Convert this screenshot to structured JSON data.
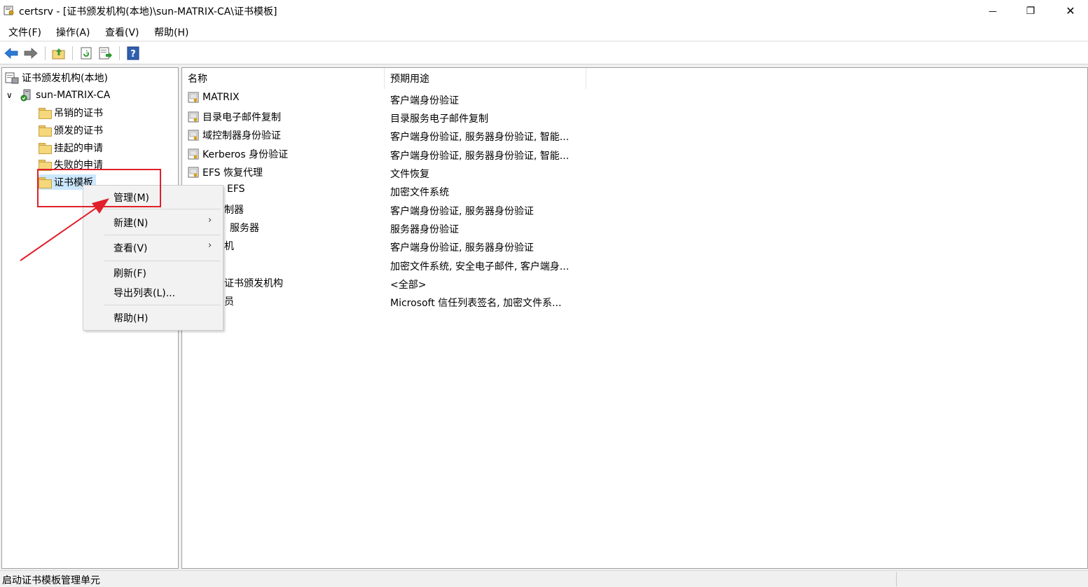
{
  "window": {
    "title": "certsrv - [证书颁发机构(本地)\\sun-MATRIX-CA\\证书模板]",
    "minimize_glyph": "—",
    "maximize_glyph": "❐",
    "close_glyph": "✕"
  },
  "menubar": {
    "items": [
      "文件(F)",
      "操作(A)",
      "查看(V)",
      "帮助(H)"
    ]
  },
  "toolbar": {
    "icons": [
      "back-arrow-icon",
      "forward-arrow-icon",
      "up-folder-icon",
      "refresh-icon",
      "export-list-icon",
      "help-icon"
    ]
  },
  "tree": {
    "root": "证书颁发机构(本地)",
    "ca": "sun-MATRIX-CA",
    "expand_glyph": "∨",
    "children": [
      "吊销的证书",
      "颁发的证书",
      "挂起的申请",
      "失败的申请",
      "证书模板"
    ]
  },
  "list": {
    "columns": [
      "名称",
      "预期用途"
    ],
    "rows": [
      {
        "name": "MATRIX",
        "purpose": "客户端身份验证"
      },
      {
        "name": "目录电子邮件复制",
        "purpose": "目录服务电子邮件复制"
      },
      {
        "name": "域控制器身份验证",
        "purpose": "客户端身份验证, 服务器身份验证, 智能..."
      },
      {
        "name": "Kerberos 身份验证",
        "purpose": "客户端身份验证, 服务器身份验证, 智能..."
      },
      {
        "name": "EFS 恢复代理",
        "purpose": "文件恢复"
      },
      {
        "name": "EFS",
        "purpose": "加密文件系统"
      },
      {
        "name": "制器",
        "purpose": "客户端身份验证, 服务器身份验证"
      },
      {
        "name": "服务器",
        "purpose": "服务器身份验证"
      },
      {
        "name": "机",
        "purpose": "客户端身份验证, 服务器身份验证"
      },
      {
        "name": "",
        "purpose": "加密文件系统, 安全电子邮件, 客户端身..."
      },
      {
        "name": "证书颁发机构",
        "purpose": "<全部>"
      },
      {
        "name": "员",
        "purpose": "Microsoft 信任列表签名, 加密文件系..."
      }
    ]
  },
  "context_menu": {
    "manage": "管理(M)",
    "new": "新建(N)",
    "view": "查看(V)",
    "refresh": "刷新(F)",
    "export": "导出列表(L)...",
    "help": "帮助(H)",
    "submenu_arrow": "›"
  },
  "statusbar": {
    "text": "启动证书模板管理单元"
  },
  "colors": {
    "highlight": "#e0202a",
    "selection": "#cce8ff"
  }
}
